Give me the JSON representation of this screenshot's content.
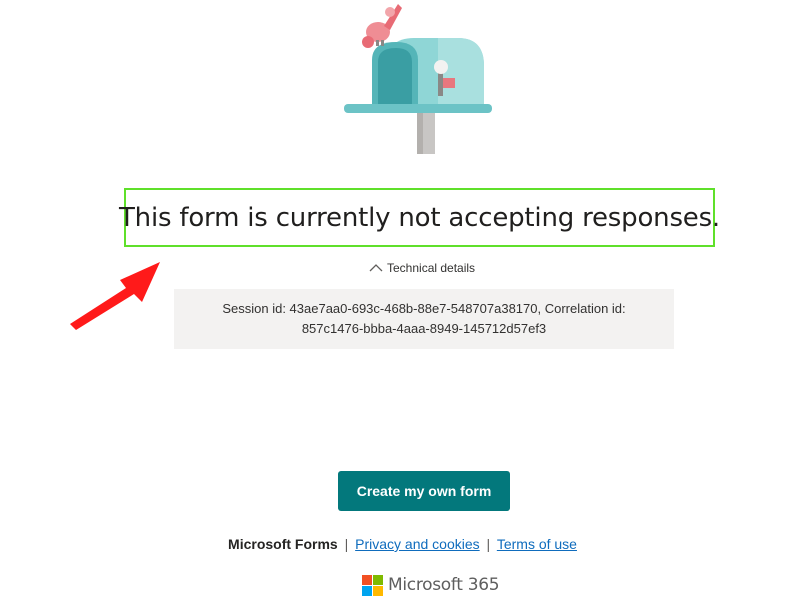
{
  "message": {
    "title": "This form is currently not accepting responses."
  },
  "technical_details": {
    "toggle_label": "Technical details",
    "session_text": "Session id: 43ae7aa0-693c-468b-88e7-548707a38170, Correlation id: 857c1476-bbba-4aaa-8949-145712d57ef3"
  },
  "create_button": {
    "label": "Create my own form"
  },
  "footer": {
    "brand": "Microsoft Forms",
    "separator": "|",
    "privacy_link": "Privacy and cookies",
    "terms_link": "Terms of use"
  },
  "product": {
    "name": "Microsoft 365"
  },
  "colors": {
    "accent": "#03787c",
    "highlight_border": "#5fe02a",
    "arrow": "#ff1a1a",
    "link": "#0f6cbd",
    "details_bg": "#f3f2f1"
  },
  "icons": {
    "illustration": "mailbox-with-bird-illustration",
    "toggle": "chevron-up-icon",
    "logo": "microsoft-logo-icon",
    "annotation": "red-arrow-annotation"
  }
}
